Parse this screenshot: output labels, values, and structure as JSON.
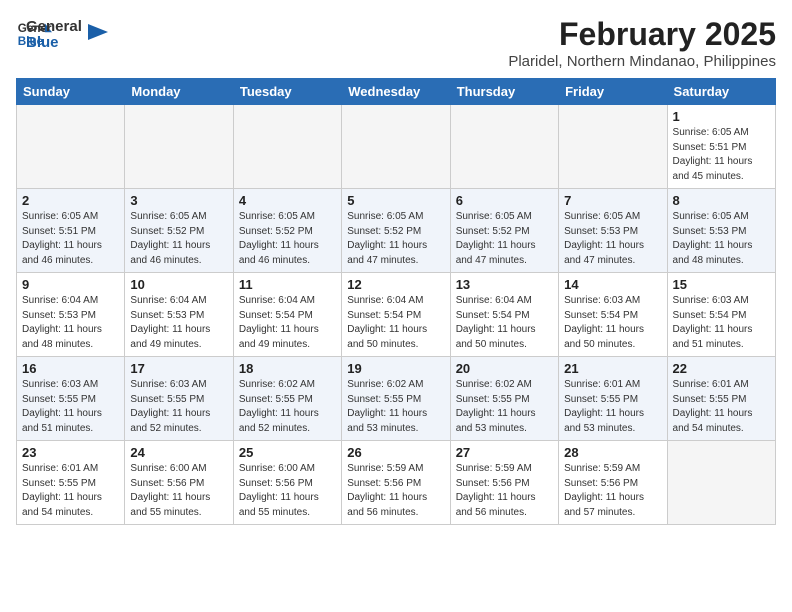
{
  "header": {
    "logo_general": "General",
    "logo_blue": "Blue",
    "month_year": "February 2025",
    "location": "Plaridel, Northern Mindanao, Philippines"
  },
  "weekdays": [
    "Sunday",
    "Monday",
    "Tuesday",
    "Wednesday",
    "Thursday",
    "Friday",
    "Saturday"
  ],
  "weeks": [
    [
      {
        "day": "",
        "info": ""
      },
      {
        "day": "",
        "info": ""
      },
      {
        "day": "",
        "info": ""
      },
      {
        "day": "",
        "info": ""
      },
      {
        "day": "",
        "info": ""
      },
      {
        "day": "",
        "info": ""
      },
      {
        "day": "1",
        "info": "Sunrise: 6:05 AM\nSunset: 5:51 PM\nDaylight: 11 hours\nand 45 minutes."
      }
    ],
    [
      {
        "day": "2",
        "info": "Sunrise: 6:05 AM\nSunset: 5:51 PM\nDaylight: 11 hours\nand 46 minutes."
      },
      {
        "day": "3",
        "info": "Sunrise: 6:05 AM\nSunset: 5:52 PM\nDaylight: 11 hours\nand 46 minutes."
      },
      {
        "day": "4",
        "info": "Sunrise: 6:05 AM\nSunset: 5:52 PM\nDaylight: 11 hours\nand 46 minutes."
      },
      {
        "day": "5",
        "info": "Sunrise: 6:05 AM\nSunset: 5:52 PM\nDaylight: 11 hours\nand 47 minutes."
      },
      {
        "day": "6",
        "info": "Sunrise: 6:05 AM\nSunset: 5:52 PM\nDaylight: 11 hours\nand 47 minutes."
      },
      {
        "day": "7",
        "info": "Sunrise: 6:05 AM\nSunset: 5:53 PM\nDaylight: 11 hours\nand 47 minutes."
      },
      {
        "day": "8",
        "info": "Sunrise: 6:05 AM\nSunset: 5:53 PM\nDaylight: 11 hours\nand 48 minutes."
      }
    ],
    [
      {
        "day": "9",
        "info": "Sunrise: 6:04 AM\nSunset: 5:53 PM\nDaylight: 11 hours\nand 48 minutes."
      },
      {
        "day": "10",
        "info": "Sunrise: 6:04 AM\nSunset: 5:53 PM\nDaylight: 11 hours\nand 49 minutes."
      },
      {
        "day": "11",
        "info": "Sunrise: 6:04 AM\nSunset: 5:54 PM\nDaylight: 11 hours\nand 49 minutes."
      },
      {
        "day": "12",
        "info": "Sunrise: 6:04 AM\nSunset: 5:54 PM\nDaylight: 11 hours\nand 50 minutes."
      },
      {
        "day": "13",
        "info": "Sunrise: 6:04 AM\nSunset: 5:54 PM\nDaylight: 11 hours\nand 50 minutes."
      },
      {
        "day": "14",
        "info": "Sunrise: 6:03 AM\nSunset: 5:54 PM\nDaylight: 11 hours\nand 50 minutes."
      },
      {
        "day": "15",
        "info": "Sunrise: 6:03 AM\nSunset: 5:54 PM\nDaylight: 11 hours\nand 51 minutes."
      }
    ],
    [
      {
        "day": "16",
        "info": "Sunrise: 6:03 AM\nSunset: 5:55 PM\nDaylight: 11 hours\nand 51 minutes."
      },
      {
        "day": "17",
        "info": "Sunrise: 6:03 AM\nSunset: 5:55 PM\nDaylight: 11 hours\nand 52 minutes."
      },
      {
        "day": "18",
        "info": "Sunrise: 6:02 AM\nSunset: 5:55 PM\nDaylight: 11 hours\nand 52 minutes."
      },
      {
        "day": "19",
        "info": "Sunrise: 6:02 AM\nSunset: 5:55 PM\nDaylight: 11 hours\nand 53 minutes."
      },
      {
        "day": "20",
        "info": "Sunrise: 6:02 AM\nSunset: 5:55 PM\nDaylight: 11 hours\nand 53 minutes."
      },
      {
        "day": "21",
        "info": "Sunrise: 6:01 AM\nSunset: 5:55 PM\nDaylight: 11 hours\nand 53 minutes."
      },
      {
        "day": "22",
        "info": "Sunrise: 6:01 AM\nSunset: 5:55 PM\nDaylight: 11 hours\nand 54 minutes."
      }
    ],
    [
      {
        "day": "23",
        "info": "Sunrise: 6:01 AM\nSunset: 5:55 PM\nDaylight: 11 hours\nand 54 minutes."
      },
      {
        "day": "24",
        "info": "Sunrise: 6:00 AM\nSunset: 5:56 PM\nDaylight: 11 hours\nand 55 minutes."
      },
      {
        "day": "25",
        "info": "Sunrise: 6:00 AM\nSunset: 5:56 PM\nDaylight: 11 hours\nand 55 minutes."
      },
      {
        "day": "26",
        "info": "Sunrise: 5:59 AM\nSunset: 5:56 PM\nDaylight: 11 hours\nand 56 minutes."
      },
      {
        "day": "27",
        "info": "Sunrise: 5:59 AM\nSunset: 5:56 PM\nDaylight: 11 hours\nand 56 minutes."
      },
      {
        "day": "28",
        "info": "Sunrise: 5:59 AM\nSunset: 5:56 PM\nDaylight: 11 hours\nand 57 minutes."
      },
      {
        "day": "",
        "info": ""
      }
    ]
  ]
}
